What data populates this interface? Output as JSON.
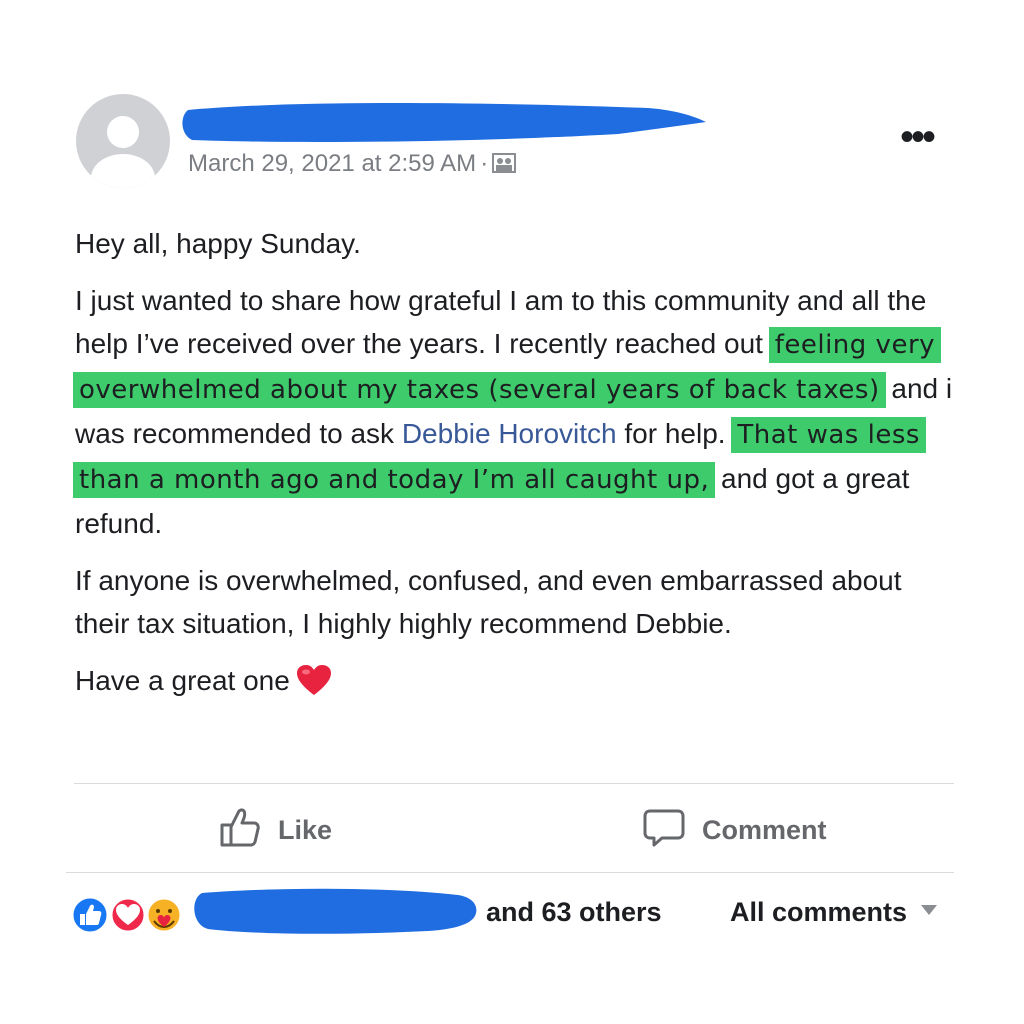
{
  "post": {
    "meta": {
      "timestamp": "March 29, 2021 at 2:59 AM",
      "separator": "·",
      "audience_icon": "group-audience-icon"
    },
    "more_options_label": "•••",
    "paragraphs": {
      "p1": "Hey all, happy Sunday.",
      "p2": {
        "a": "I just wanted to share how grateful I am to this community and all the help I’ve received over the years. I recently reached out",
        "hl1": "feeling very overwhelmed about my taxes (several years of back taxes)",
        "b": "and i was recommended to ask",
        "mention": "Debbie Horovitch",
        "c": "for help.",
        "hl2": "That was less than a month ago and today I’m all caught up,",
        "d": "and got a great refund."
      },
      "p3": "If anyone is overwhelmed, confused, and even embarrassed about their tax situation, I highly highly recommend Debbie.",
      "p4": "Have a great one",
      "p4_emoji": "red-heart-icon"
    },
    "actions": {
      "like_label": "Like",
      "comment_label": "Comment"
    },
    "footer": {
      "reaction_icons": [
        "like-reaction-icon",
        "love-reaction-icon",
        "care-reaction-icon"
      ],
      "others_text": "and 63 others",
      "all_comments_label": "All comments"
    }
  },
  "colors": {
    "highlight": "#3ecb6b",
    "redaction": "#1f6de0",
    "mention": "#385898",
    "meta_text": "#7a7d82"
  }
}
